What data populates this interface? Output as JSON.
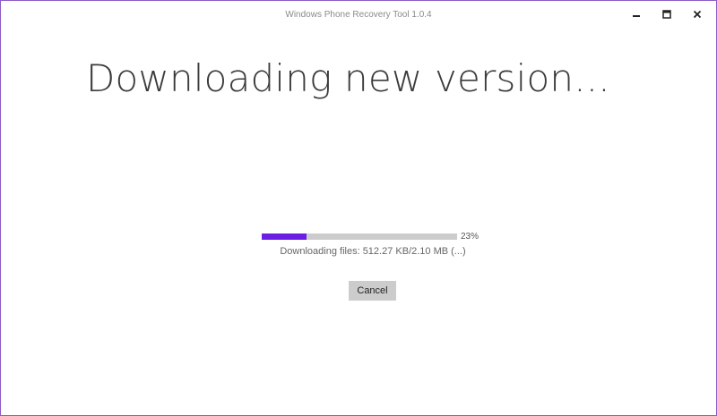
{
  "window": {
    "title": "Windows Phone Recovery Tool 1.0.4",
    "controls": {
      "minimize_icon": "minimize-icon",
      "maximize_icon": "maximize-icon",
      "close_icon": "close-icon"
    },
    "border_color": "#8d5ac7"
  },
  "main": {
    "heading": "Downloading new version...",
    "progress": {
      "percent_value": 23,
      "percent_label": "23%",
      "fill_color": "#6a1fe3",
      "track_color": "#cccccc"
    },
    "status_text": "Downloading files: 512.27 KB/2.10 MB (...)",
    "cancel_label": "Cancel"
  }
}
